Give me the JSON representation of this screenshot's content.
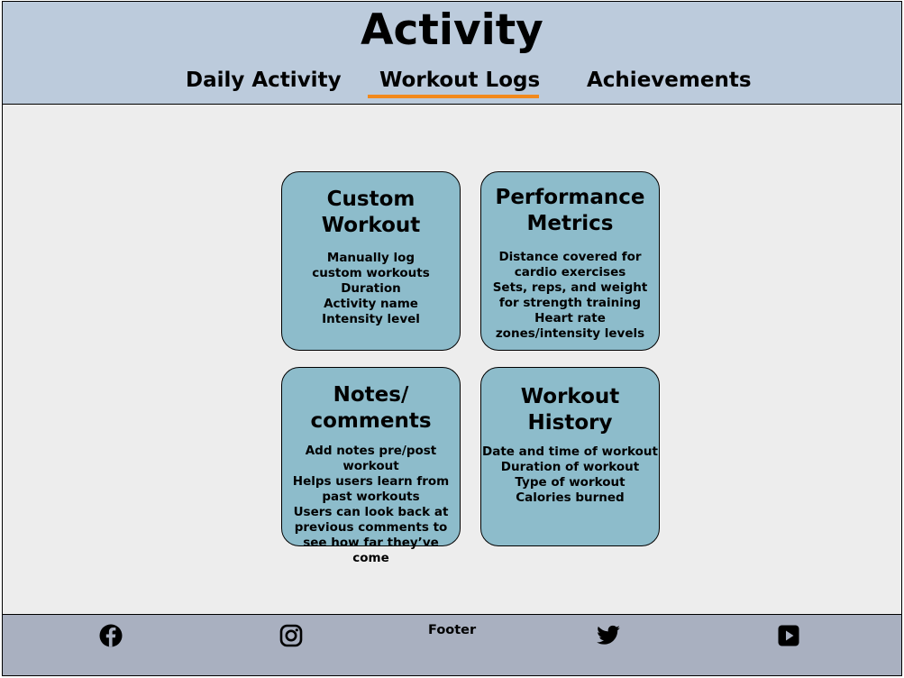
{
  "header": {
    "title": "Activity",
    "tabs": [
      {
        "label": "Daily Activity"
      },
      {
        "label": "Workout Logs",
        "active": true
      },
      {
        "label": "Achievements"
      }
    ],
    "active_tab_color": "#f2891c"
  },
  "cards": [
    {
      "title": "Custom Workout",
      "lines": [
        "Manually log",
        "custom workouts",
        "Duration",
        "Activity name",
        "Intensity level"
      ]
    },
    {
      "title": "Performance Metrics",
      "lines": [
        "Distance covered for cardio exercises",
        "Sets, reps, and weight for strength training",
        "Heart rate zones/intensity levels"
      ]
    },
    {
      "title": "Notes/ comments",
      "lines": [
        "Add notes pre/post workout",
        "Helps users learn from past workouts",
        "Users can look back at previous comments to see how far they’ve come"
      ]
    },
    {
      "title": "Workout History",
      "lines": [
        "Date and time of workout",
        "Duration of workout",
        "Type of workout",
        "Calories burned"
      ]
    }
  ],
  "footer": {
    "label": "Footer",
    "social": [
      "facebook-icon",
      "instagram-icon",
      "twitter-icon",
      "youtube-icon"
    ]
  },
  "colors": {
    "header_bg": "#bccbdc",
    "content_bg": "#ededed",
    "card_bg": "#8dbccb",
    "footer_bg": "#a9b0c0"
  }
}
